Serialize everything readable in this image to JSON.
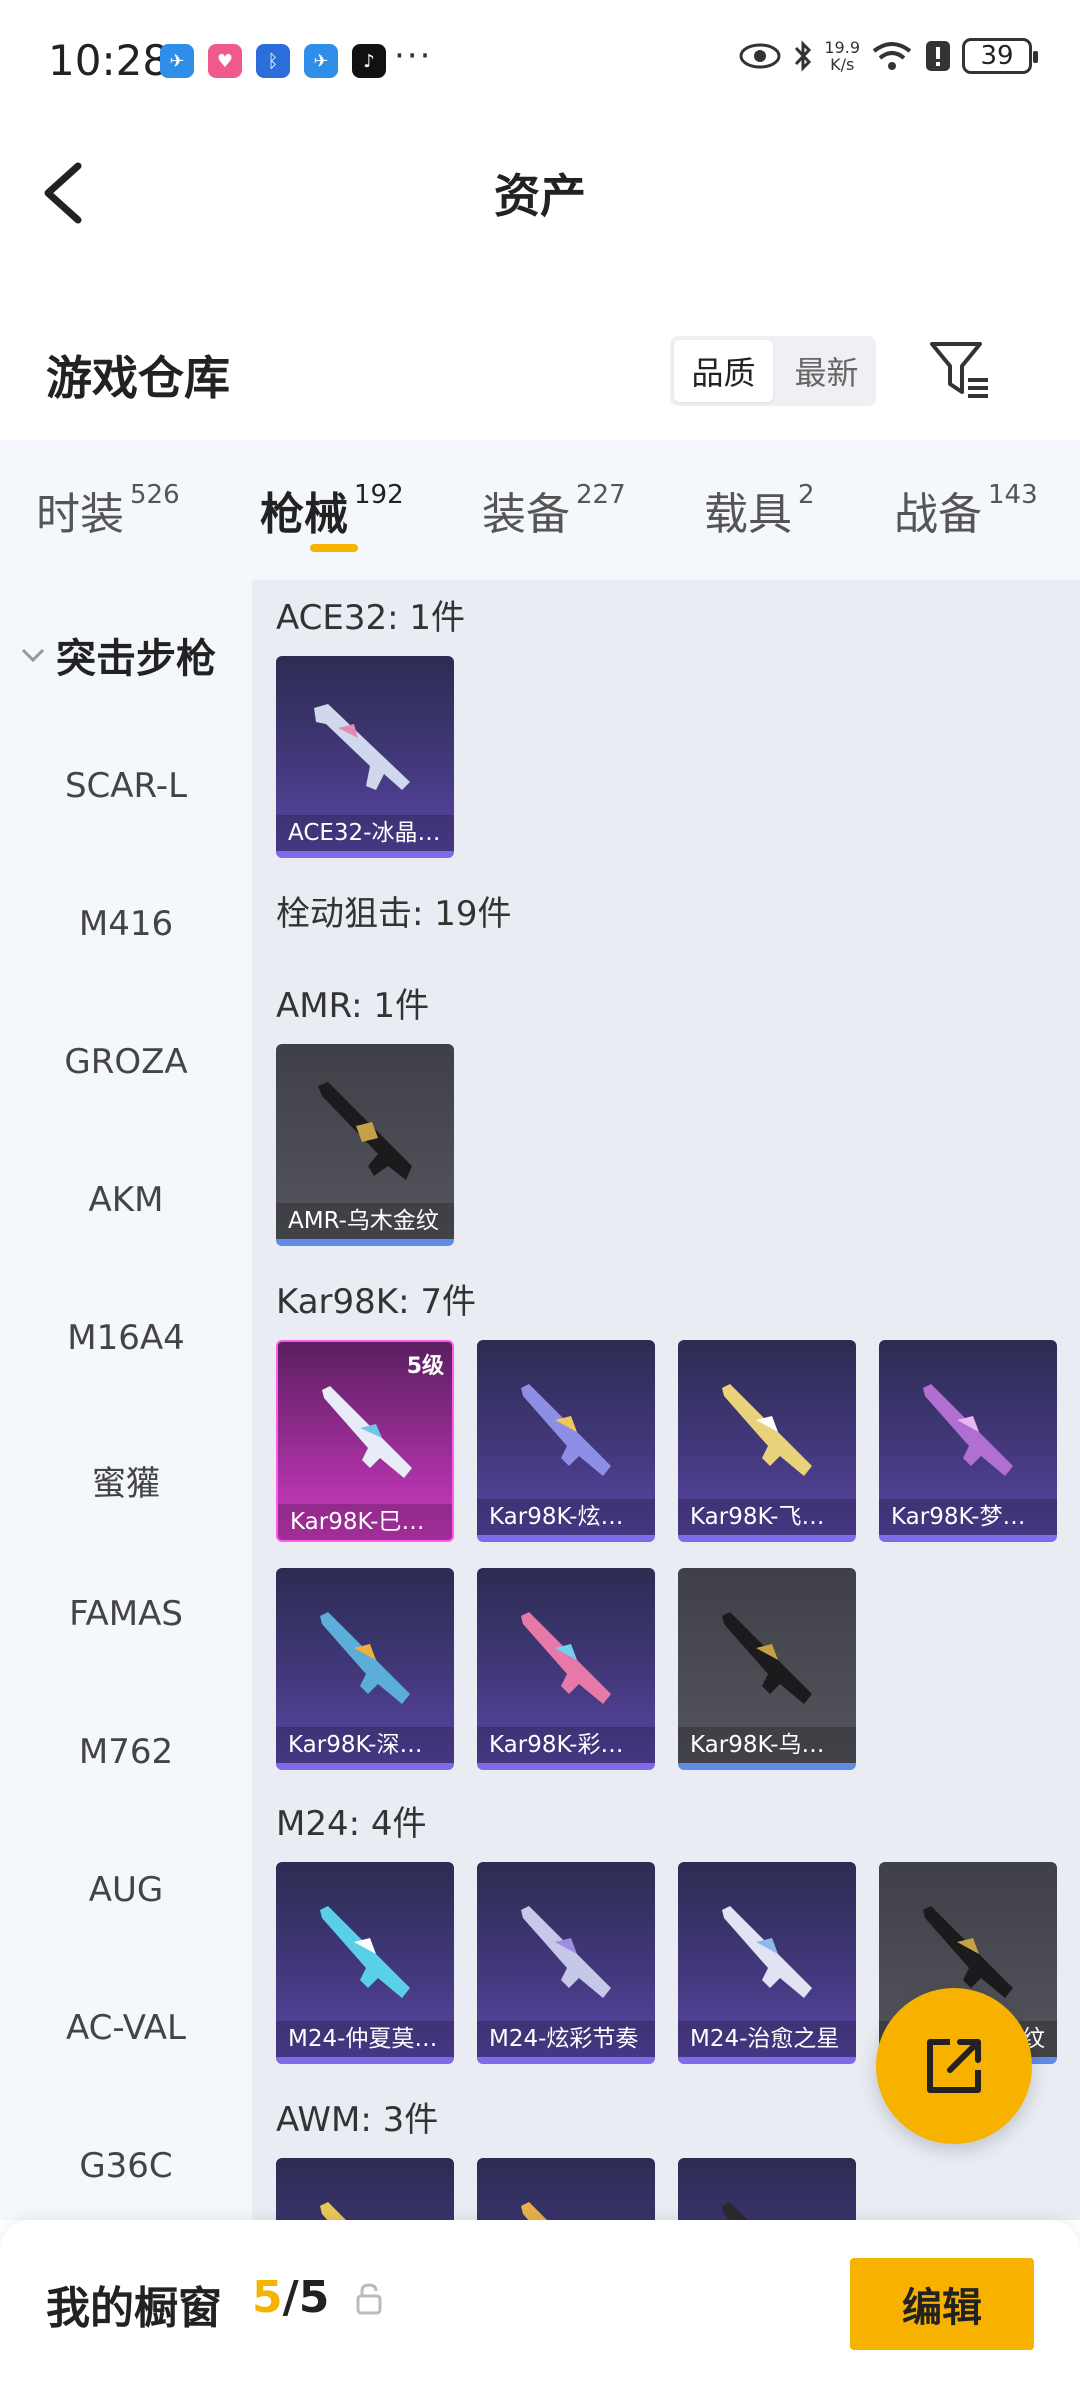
{
  "status_bar": {
    "time": "10:28",
    "more": "···",
    "speed_top": "19.9",
    "speed_bottom": "K/s",
    "battery": "39"
  },
  "header": {
    "title": "资产"
  },
  "section": {
    "title": "游戏仓库",
    "sort_options": [
      "品质",
      "最新"
    ]
  },
  "tabs": [
    {
      "label": "时装",
      "count": "526"
    },
    {
      "label": "枪械",
      "count": "192"
    },
    {
      "label": "装备",
      "count": "227"
    },
    {
      "label": "载具",
      "count": "2"
    },
    {
      "label": "战备",
      "count": "143"
    }
  ],
  "sidebar": {
    "group": "突击步枪",
    "items": [
      "SCAR-L",
      "M416",
      "GROZA",
      "AKM",
      "M16A4",
      "蜜獾",
      "FAMAS",
      "M762",
      "AUG",
      "AC-VAL",
      "G36C"
    ]
  },
  "groups": [
    {
      "title": "ACE32: 1件",
      "cards": [
        {
          "label": "ACE32-冰晶…",
          "style": "purple"
        }
      ]
    },
    {
      "title": "栓动狙击: 19件",
      "cards": []
    },
    {
      "title": "AMR: 1件",
      "cards": [
        {
          "label": "AMR-乌木金纹",
          "style": "gray"
        }
      ]
    },
    {
      "title": "Kar98K: 7件",
      "cards": [
        {
          "label": "Kar98K-巳…",
          "style": "pink",
          "level": "5级"
        },
        {
          "label": "Kar98K-炫…",
          "style": "purple"
        },
        {
          "label": "Kar98K-飞…",
          "style": "purple"
        },
        {
          "label": "Kar98K-梦…",
          "style": "purple"
        },
        {
          "label": "Kar98K-深…",
          "style": "purple"
        },
        {
          "label": "Kar98K-彩…",
          "style": "purple"
        },
        {
          "label": "Kar98K-乌…",
          "style": "gray"
        }
      ]
    },
    {
      "title": "M24: 4件",
      "cards": [
        {
          "label": "M24-仲夏莫…",
          "style": "purple"
        },
        {
          "label": "M24-炫彩节奏",
          "style": "purple"
        },
        {
          "label": "M24-治愈之星",
          "style": "purple"
        },
        {
          "label": "纹",
          "style": "gray"
        }
      ]
    },
    {
      "title": "AWM: 3件",
      "cards": [
        {
          "label": "",
          "style": "purple"
        },
        {
          "label": "",
          "style": "purple"
        },
        {
          "label": "",
          "style": "purple"
        }
      ]
    }
  ],
  "bottom_bar": {
    "title": "我的橱窗",
    "current": "5",
    "total": "/5",
    "edit_label": "编辑"
  }
}
